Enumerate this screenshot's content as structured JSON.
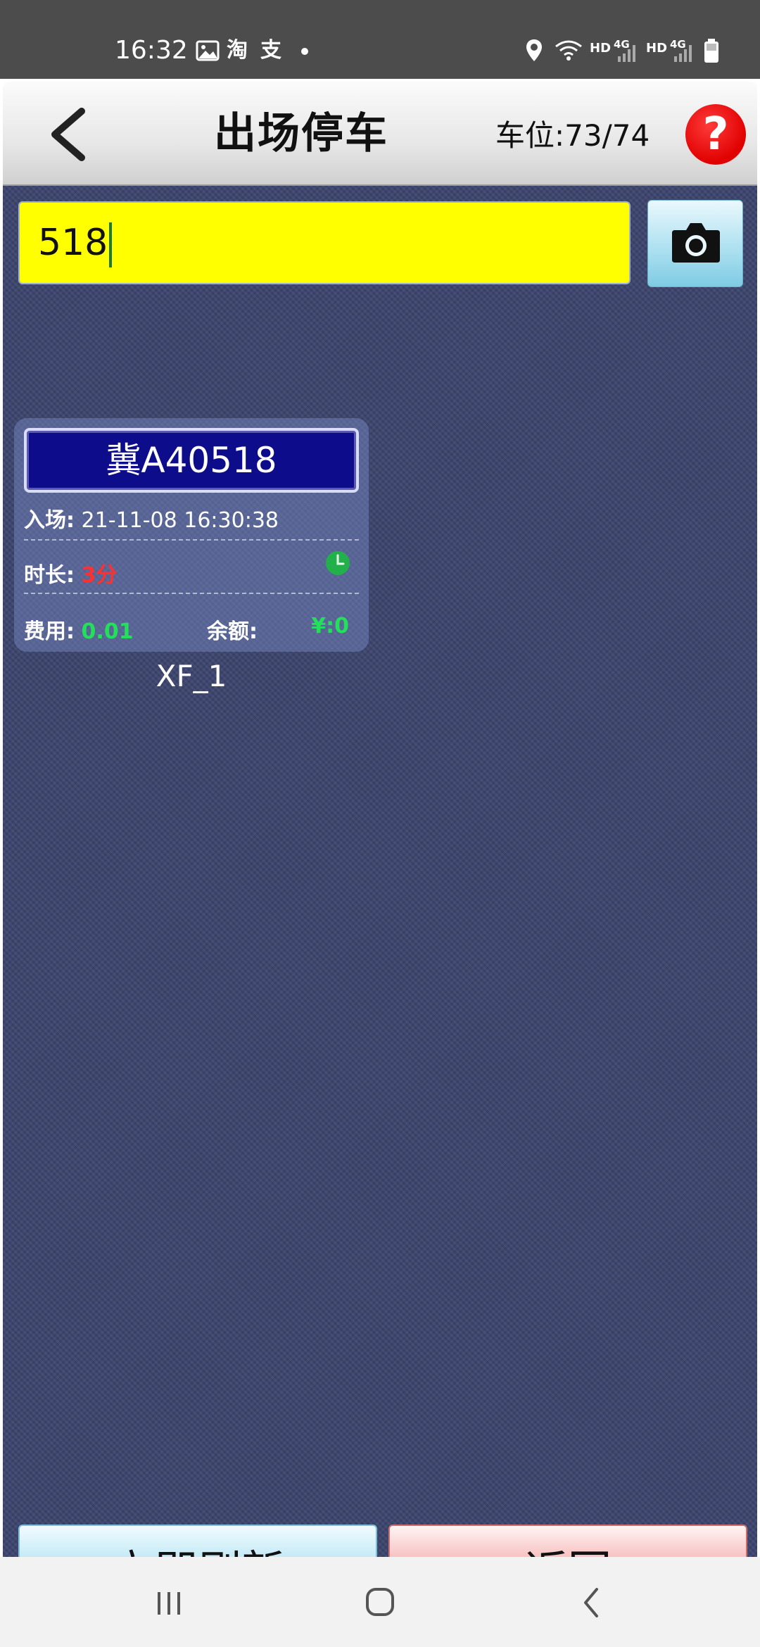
{
  "status_bar": {
    "time": "16:32",
    "app_glyph_1": "淘",
    "app_glyph_2": "支",
    "network_1": "HD",
    "network_1_type": "4G",
    "network_2": "HD",
    "network_2_type": "4G"
  },
  "header": {
    "title": "出场停车",
    "spaces_label": "车位:73/74",
    "help_label": "?"
  },
  "search": {
    "value": "518"
  },
  "vehicle": {
    "plate": "冀A40518",
    "entry_label": "入场:",
    "entry_time": "21-11-08 16:30:38",
    "duration_label": "时长:",
    "duration_value": "3分",
    "fee_label": "费用:",
    "fee_value": "0.01",
    "balance_label": "余额:",
    "balance_value": "¥:0",
    "space_name": "XF_1"
  },
  "buttons": {
    "refresh_label": "立即刷新",
    "back_label": "返回"
  },
  "colors": {
    "search_bg": "#ffff00",
    "content_bg": "#3b436c",
    "plate_bg": "#0d0d8c",
    "duration_color": "#ff3030",
    "fee_color": "#22e05a",
    "help_color": "#e00000"
  }
}
